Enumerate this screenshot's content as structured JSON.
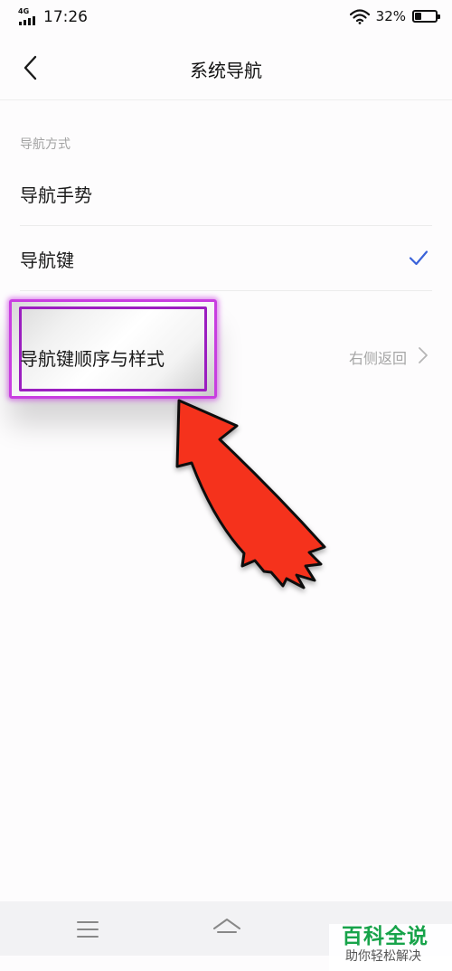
{
  "status_bar": {
    "network": "4G",
    "time": "17:26",
    "battery_percent": "32%",
    "battery_level": 0.32,
    "icons": [
      "signal-icon",
      "wifi-icon",
      "battery-icon"
    ]
  },
  "header": {
    "title": "系统导航",
    "back_icon": "chevron-left-icon"
  },
  "section": {
    "label": "导航方式"
  },
  "options": [
    {
      "label": "导航手势",
      "selected": false
    },
    {
      "label": "导航键",
      "selected": true
    }
  ],
  "order_row": {
    "label": "导航键顺序与样式",
    "value": "右侧返回",
    "icon": "chevron-right-icon"
  },
  "annotation": {
    "highlight_color": "#c83ee0",
    "arrow_color": "#f5321e"
  },
  "nav_bar": {
    "icons": [
      "menu-icon",
      "home-icon"
    ]
  },
  "watermark": {
    "title": "百科全说",
    "subtitle": "助你轻松解决"
  },
  "colors": {
    "accent": "#3a62d9",
    "background": "#fdfcfd"
  }
}
